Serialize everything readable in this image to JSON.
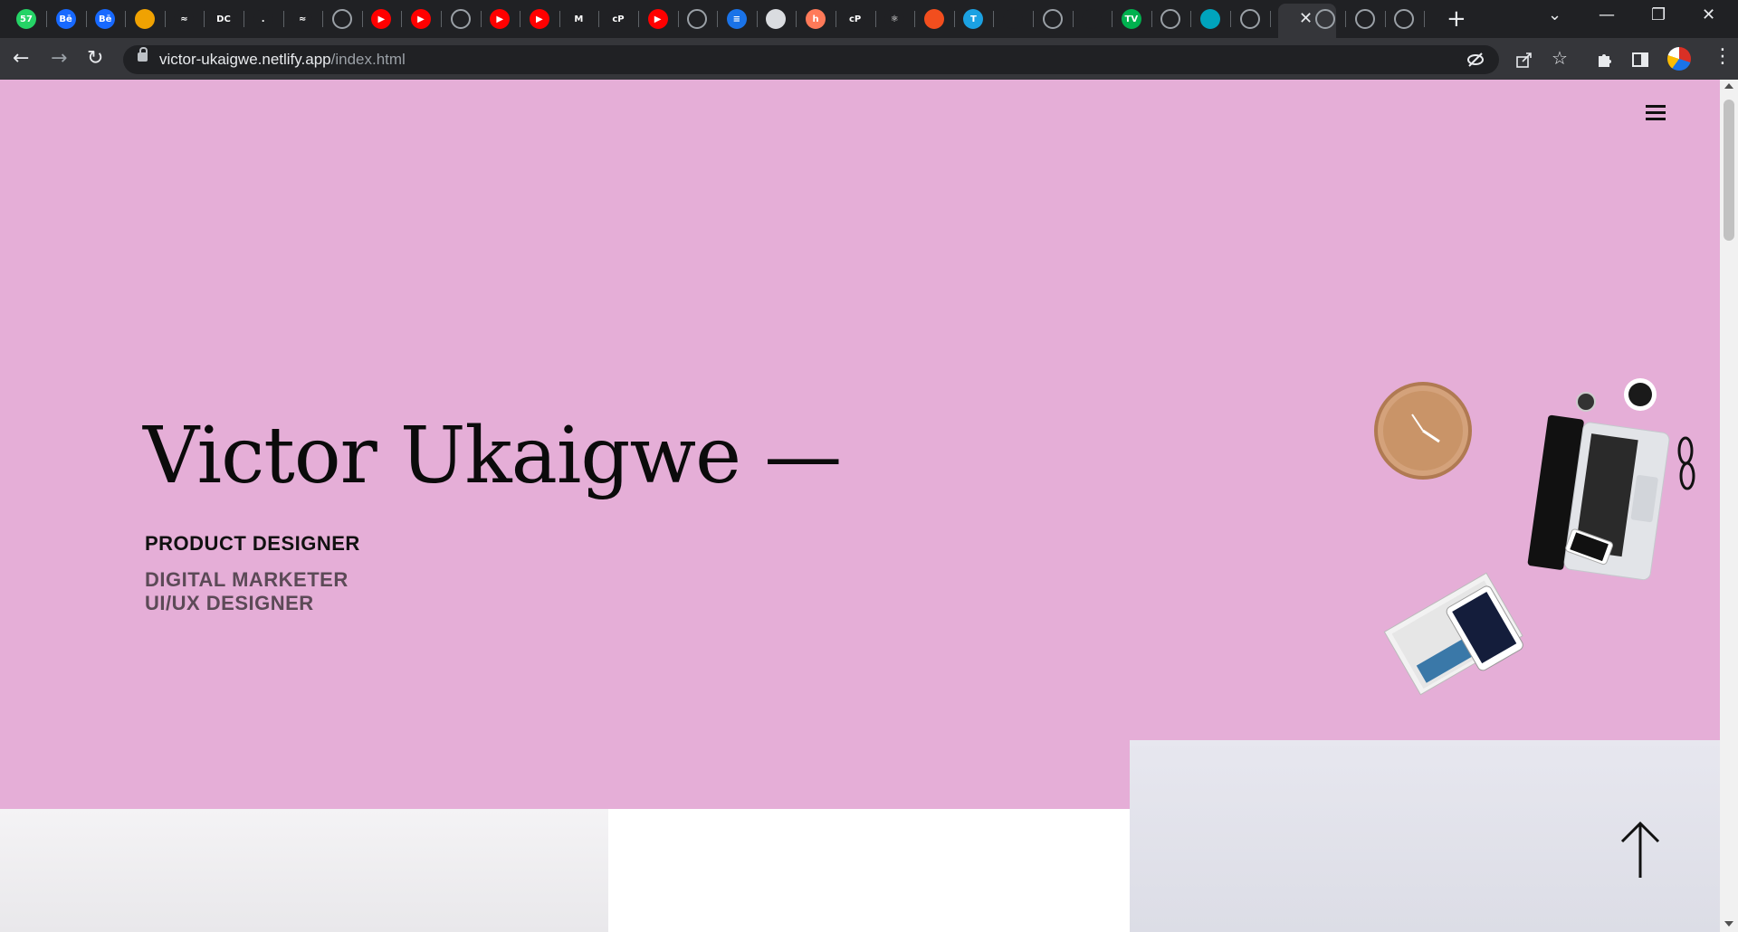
{
  "browser": {
    "tabs": [
      {
        "icon": "whatsapp-icon",
        "text": "57",
        "bg": "#25d366"
      },
      {
        "icon": "behance-icon",
        "text": "Bē",
        "bg": "#1769ff"
      },
      {
        "icon": "behance-icon",
        "text": "Bē",
        "bg": "#1769ff"
      },
      {
        "icon": "cat-icon",
        "text": "",
        "bg": "#f0a202"
      },
      {
        "icon": "binance-icon",
        "text": "≈",
        "bg": "#202124"
      },
      {
        "icon": "dc-icon",
        "text": "DC",
        "bg": "#202124"
      },
      {
        "icon": "dot-icon",
        "text": ".",
        "bg": "#202124"
      },
      {
        "icon": "binance-icon",
        "text": "≈",
        "bg": "#202124"
      },
      {
        "icon": "globe-icon",
        "text": "",
        "bg": "#9aa0a6"
      },
      {
        "icon": "youtube-icon",
        "text": "▶",
        "bg": "#ff0000"
      },
      {
        "icon": "youtube-icon",
        "text": "▶",
        "bg": "#ff0000"
      },
      {
        "icon": "globe-icon",
        "text": "",
        "bg": "#9aa0a6"
      },
      {
        "icon": "youtube-icon",
        "text": "▶",
        "bg": "#ff0000"
      },
      {
        "icon": "youtube-icon",
        "text": "▶",
        "bg": "#ff0000"
      },
      {
        "icon": "gmail-icon",
        "text": "M",
        "bg": "#202124"
      },
      {
        "icon": "cp-icon",
        "text": "cP",
        "bg": "#202124"
      },
      {
        "icon": "youtube-icon",
        "text": "▶",
        "bg": "#ff0000"
      },
      {
        "icon": "globe-icon",
        "text": "",
        "bg": "#9aa0a6"
      },
      {
        "icon": "docs-icon",
        "text": "≡",
        "bg": "#1a73e8"
      },
      {
        "icon": "image-icon",
        "text": "",
        "bg": "#dadce0"
      },
      {
        "icon": "hubspot-icon",
        "text": "h",
        "bg": "#ff7a59"
      },
      {
        "icon": "cp-icon",
        "text": "cP",
        "bg": "#202124"
      },
      {
        "icon": "react-icon",
        "text": "⚛",
        "bg": "#202124"
      },
      {
        "icon": "figma-icon",
        "text": "",
        "bg": "#f24e1e"
      },
      {
        "icon": "t-icon",
        "text": "T",
        "bg": "#1ba1e2"
      },
      {
        "icon": "phone-icon",
        "text": "",
        "bg": "#202124"
      },
      {
        "icon": "globe-icon",
        "text": "",
        "bg": "#9aa0a6"
      },
      {
        "icon": "gauge-icon",
        "text": "",
        "bg": "#202124"
      },
      {
        "icon": "tv-icon",
        "text": "TV",
        "bg": "#00b14f"
      },
      {
        "icon": "globe-icon",
        "text": "",
        "bg": "#9aa0a6"
      },
      {
        "icon": "diamond-icon",
        "text": "",
        "bg": "#00a4bd"
      },
      {
        "icon": "globe-icon",
        "text": "",
        "bg": "#9aa0a6"
      },
      {
        "icon": "globe-icon",
        "text": "",
        "bg": "#9aa0a6"
      },
      {
        "icon": "globe-icon",
        "text": "",
        "bg": "#9aa0a6"
      },
      {
        "icon": "globe-icon",
        "text": "",
        "bg": "#9aa0a6"
      }
    ],
    "active_tab_close": "✕",
    "new_tab": "+",
    "window": {
      "dropdown": "⌄",
      "minimize": "—",
      "restore": "❐",
      "close": "✕"
    },
    "nav": {
      "back": "←",
      "forward": "→",
      "reload": "↻"
    },
    "url_host": "victor-ukaigwe.netlify.app",
    "url_path": "/index.html",
    "toolbar_icons": [
      "eye-off-icon",
      "share-icon",
      "star-icon",
      "extensions-icon",
      "sidepanel-icon",
      "profile-avatar",
      "menu-dots-icon"
    ]
  },
  "hero": {
    "name": "Victor Ukaigwe —",
    "roles": [
      "PRODUCT DESIGNER",
      "DIGITAL MARKETER",
      "UI/UX DESIGNER"
    ],
    "bg_color": "#e5aed7",
    "illustration": "desk-flatlay-illustration"
  },
  "menu_icon": "hamburger-menu-icon",
  "scroll_top_icon": "arrow-up-icon"
}
